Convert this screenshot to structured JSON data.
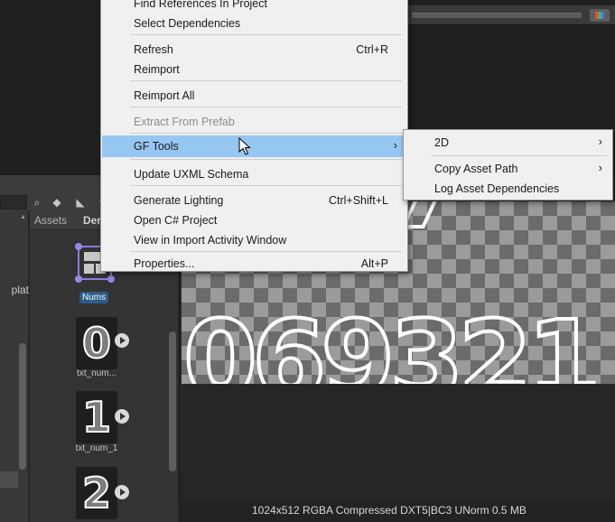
{
  "project": {
    "breadcrumb_root": "Assets",
    "breadcrumb_sep": "›",
    "breadcrumb_current": "Der",
    "folder_label": "plat",
    "assets": [
      {
        "label": "Nums",
        "glyph": "",
        "selected": true
      },
      {
        "label": "txt_num...",
        "glyph": "0",
        "selected": false
      },
      {
        "label": "txt_num_1",
        "glyph": "1",
        "selected": false
      },
      {
        "label": "",
        "glyph": "2",
        "selected": false
      }
    ]
  },
  "preview": {
    "digits_row1": "8547",
    "digits_row2": "069321",
    "info": "1024x512 RGBA Compressed DXT5|BC3 UNorm   0.5 MB"
  },
  "context_menu": {
    "items": [
      {
        "label": "Find References In Project",
        "shortcut": ""
      },
      {
        "label": "Select Dependencies",
        "shortcut": ""
      },
      {
        "label": "Refresh",
        "shortcut": "Ctrl+R"
      },
      {
        "label": "Reimport",
        "shortcut": ""
      },
      {
        "label": "Reimport All",
        "shortcut": ""
      },
      {
        "label": "Extract From Prefab",
        "shortcut": "",
        "disabled": true
      },
      {
        "label": "GF Tools",
        "shortcut": "",
        "submenu": true,
        "highlight": true
      },
      {
        "label": "Update UXML Schema",
        "shortcut": ""
      },
      {
        "label": "Generate Lighting",
        "shortcut": "Ctrl+Shift+L"
      },
      {
        "label": "Open C# Project",
        "shortcut": ""
      },
      {
        "label": "View in Import Activity Window",
        "shortcut": ""
      },
      {
        "label": "Properties...",
        "shortcut": "Alt+P"
      }
    ],
    "arrow": "›"
  },
  "submenu": {
    "items": [
      {
        "label": "2D",
        "submenu": true
      },
      {
        "label": "Copy Asset Path",
        "submenu": true
      },
      {
        "label": "Log Asset Dependencies",
        "submenu": false
      }
    ]
  },
  "icons": [
    "color-channel-icon",
    "search-icon",
    "filter-type-icon",
    "filter-label-icon",
    "favorite-icon",
    "play-icon",
    "mouse-cursor-icon"
  ],
  "colors": {
    "menu_bg": "#f0f0f0",
    "menu_highlight": "#96c7f3",
    "selection_blue": "#2c5d87"
  }
}
